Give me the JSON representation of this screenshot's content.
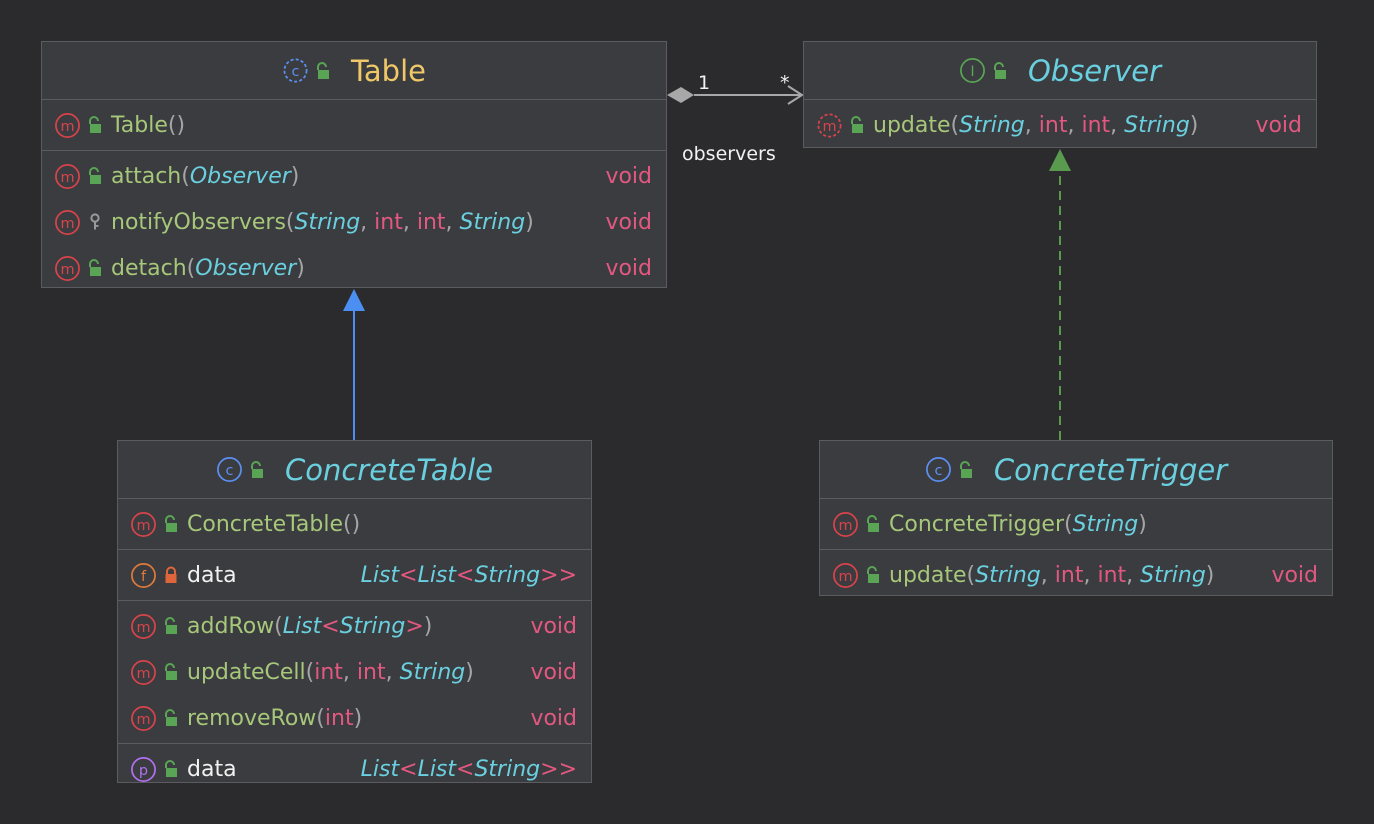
{
  "colors": {
    "background": "#2b2b2d",
    "class_icon": "#5c8ff0",
    "interface_icon": "#5aa455",
    "method_icon": "#d9434b",
    "field_icon": "#e07a3a",
    "property_icon": "#b36ff0",
    "inherit_arrow": "#4c8ff2",
    "implements_arrow": "#5a9a4e",
    "association": "#a8a8a8"
  },
  "table": {
    "kind": "class",
    "name": "Table",
    "constructors": [
      {
        "icon": "method-icon",
        "name": "Table",
        "visibility": "public"
      }
    ],
    "methods": [
      {
        "name": "attach",
        "visibility": "public",
        "ret": "void",
        "params": [
          {
            "t": "Observer",
            "k": "type"
          }
        ]
      },
      {
        "name": "notifyObservers",
        "visibility": "package",
        "ret": "void",
        "params": [
          {
            "t": "String",
            "k": "type"
          },
          {
            "t": "int",
            "k": "prim"
          },
          {
            "t": "int",
            "k": "prim"
          },
          {
            "t": "String",
            "k": "type"
          }
        ]
      },
      {
        "name": "detach",
        "visibility": "public",
        "ret": "void",
        "params": [
          {
            "t": "Observer",
            "k": "type"
          }
        ]
      }
    ]
  },
  "observer": {
    "kind": "interface",
    "name": "Observer",
    "methods": [
      {
        "name": "update",
        "visibility": "public",
        "abstract": true,
        "ret": "void",
        "params": [
          {
            "t": "String",
            "k": "type"
          },
          {
            "t": "int",
            "k": "prim"
          },
          {
            "t": "int",
            "k": "prim"
          },
          {
            "t": "String",
            "k": "type"
          }
        ]
      }
    ]
  },
  "concrete_table": {
    "kind": "class",
    "name": "ConcreteTable",
    "constructor": "ConcreteTable",
    "field": {
      "name": "data",
      "type": "List<List<String>>"
    },
    "methods": [
      {
        "name": "addRow",
        "ret": "void",
        "params": [
          {
            "t": "List<String>",
            "k": "generic"
          }
        ]
      },
      {
        "name": "updateCell",
        "ret": "void",
        "params": [
          {
            "t": "int",
            "k": "prim"
          },
          {
            "t": "int",
            "k": "prim"
          },
          {
            "t": "String",
            "k": "type"
          }
        ]
      },
      {
        "name": "removeRow",
        "ret": "void",
        "params": [
          {
            "t": "int",
            "k": "prim"
          }
        ]
      }
    ],
    "property": {
      "name": "data",
      "type": "List<List<String>>"
    }
  },
  "concrete_trigger": {
    "kind": "class",
    "name": "ConcreteTrigger",
    "constructor": "ConcreteTrigger",
    "constructor_params": [
      {
        "t": "String",
        "k": "type"
      }
    ],
    "methods": [
      {
        "name": "update",
        "ret": "void",
        "params": [
          {
            "t": "String",
            "k": "type"
          },
          {
            "t": "int",
            "k": "prim"
          },
          {
            "t": "int",
            "k": "prim"
          },
          {
            "t": "String",
            "k": "type"
          }
        ]
      }
    ]
  },
  "association": {
    "source_mult": "1",
    "target_mult": "*",
    "role": "observers"
  }
}
